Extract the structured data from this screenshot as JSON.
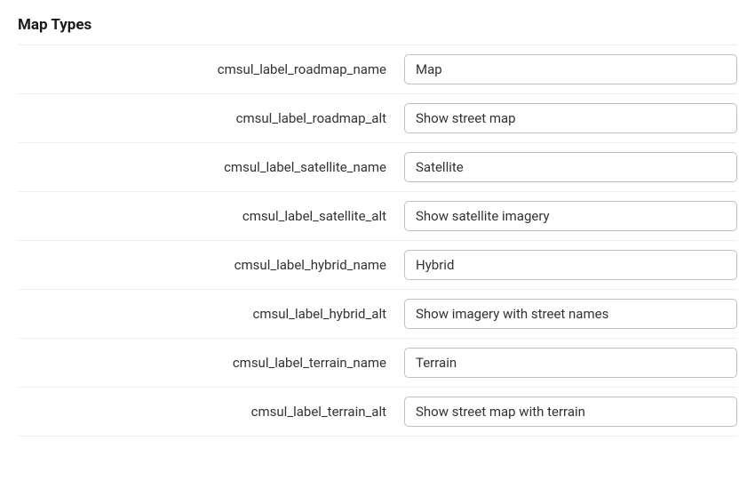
{
  "section": {
    "title": "Map Types"
  },
  "fields": [
    {
      "label": "cmsul_label_roadmap_name",
      "value": "Map"
    },
    {
      "label": "cmsul_label_roadmap_alt",
      "value": "Show street map"
    },
    {
      "label": "cmsul_label_satellite_name",
      "value": "Satellite"
    },
    {
      "label": "cmsul_label_satellite_alt",
      "value": "Show satellite imagery"
    },
    {
      "label": "cmsul_label_hybrid_name",
      "value": "Hybrid"
    },
    {
      "label": "cmsul_label_hybrid_alt",
      "value": "Show imagery with street names"
    },
    {
      "label": "cmsul_label_terrain_name",
      "value": "Terrain"
    },
    {
      "label": "cmsul_label_terrain_alt",
      "value": "Show street map with terrain"
    }
  ]
}
